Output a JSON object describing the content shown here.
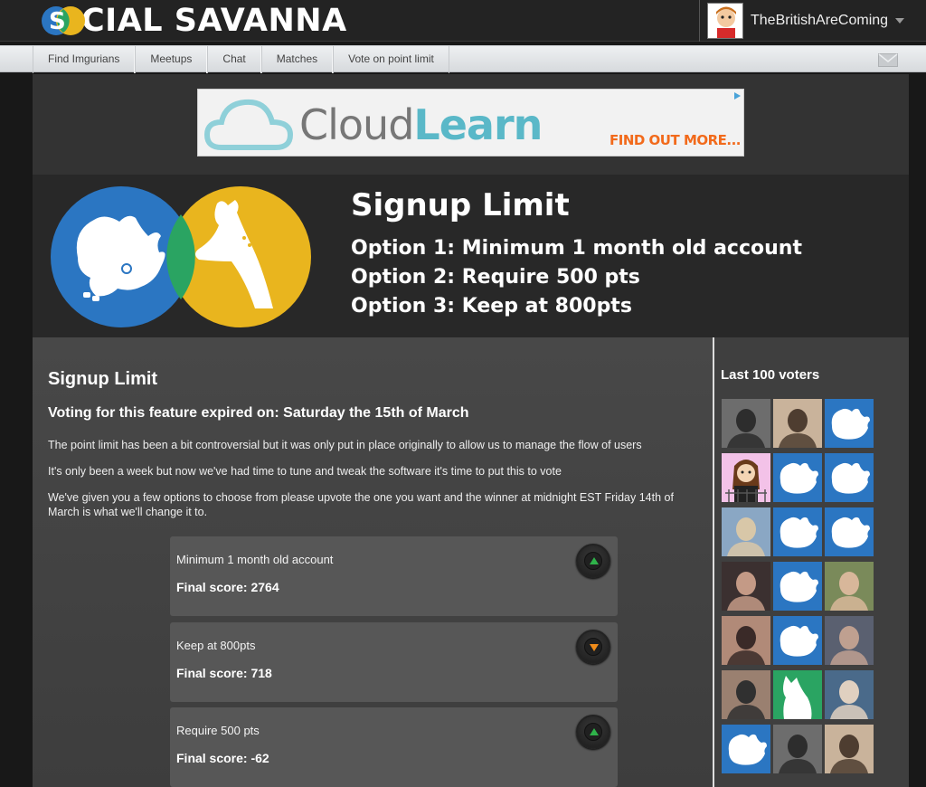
{
  "header": {
    "logo_text": "CIAL SAVANNA",
    "username": "TheBritishAreComing"
  },
  "nav": {
    "items": [
      {
        "label": "Find Imgurians"
      },
      {
        "label": "Meetups"
      },
      {
        "label": "Chat"
      },
      {
        "label": "Matches"
      },
      {
        "label": "Vote on point limit"
      }
    ]
  },
  "ad": {
    "brand_light": "Cloud",
    "brand_bold": "Learn",
    "cta": "FIND OUT MORE..."
  },
  "banner": {
    "title": "Signup Limit",
    "options": [
      "Option 1: Minimum 1 month old account",
      "Option 2: Require 500 pts",
      "Option 3: Keep at 800pts"
    ]
  },
  "main": {
    "heading": "Signup Limit",
    "expired": "Voting for this feature expired on: Saturday the 15th of March",
    "paragraphs": [
      "The point limit has been a bit controversial but it was only put in place originally to allow us to manage the flow of users",
      "It's only been a week but now we've had time to tune and tweak the software it's time to put this to vote",
      "We've given you a few options to choose from please upvote the one you want and the winner at midnight EST Friday 14th of March is what we'll change it to."
    ],
    "options": [
      {
        "label": "Minimum 1 month old account",
        "score": "Final score: 2764",
        "vote": "up"
      },
      {
        "label": "Keep at 800pts",
        "score": "Final score: 718",
        "vote": "down"
      },
      {
        "label": "Require 500 pts",
        "score": "Final score: -62",
        "vote": "up"
      }
    ]
  },
  "sidebar": {
    "title": "Last 100 voters",
    "voters": [
      "photo",
      "photo",
      "rhino",
      "cartoon",
      "rhino",
      "rhino",
      "photo",
      "rhino",
      "rhino",
      "photo",
      "rhino",
      "photo",
      "photo",
      "rhino",
      "photo",
      "photo",
      "giraffe",
      "photo",
      "rhino",
      "photo",
      "photo"
    ]
  },
  "colors": {
    "rhino_blue": "#2b76c2",
    "giraffe_yellow": "#e9b51e",
    "overlap_green": "#2aa462",
    "upvote_green": "#2fb34a",
    "downvote_orange": "#f08c1a"
  }
}
